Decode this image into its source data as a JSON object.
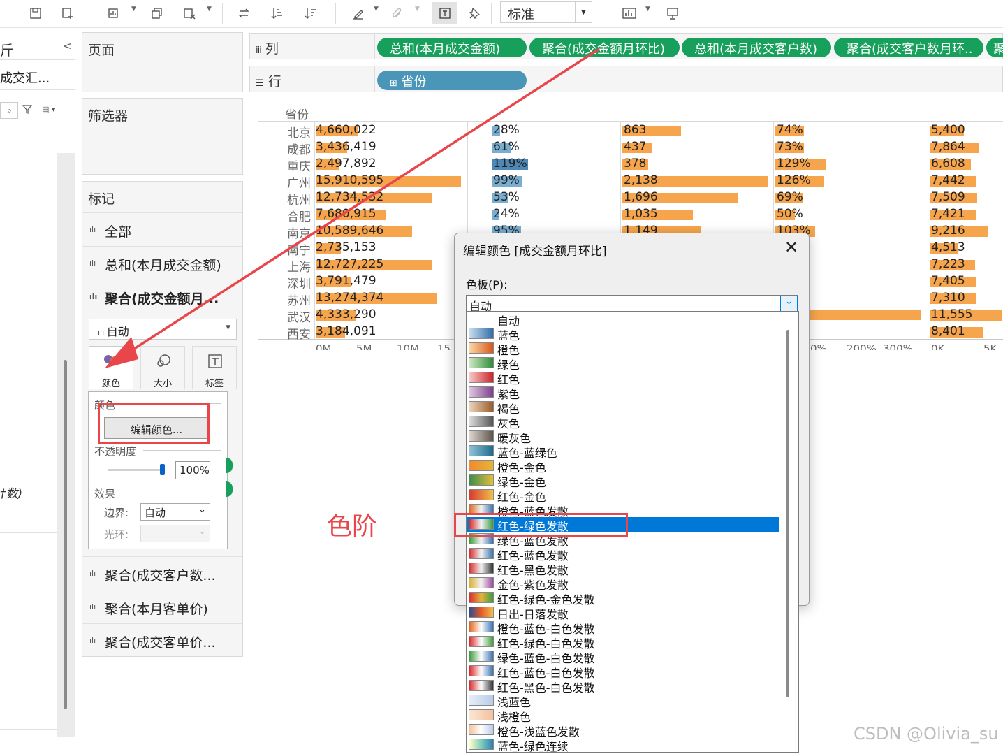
{
  "toolbar": {
    "fit_select": "标准",
    "icons": [
      "save-icon",
      "new-datasource-icon",
      "new-worksheet-icon",
      "duplicate-icon",
      "clear-sheet-icon",
      "swap-icon",
      "sort-asc-icon",
      "sort-desc-icon",
      "highlight-icon",
      "group-icon",
      "label-icon",
      "pin-icon",
      "show-me-icon",
      "presentation-icon"
    ]
  },
  "left_pane": {
    "title_fragment": "斤",
    "source_fragment": "成交汇...",
    "collapse": "<",
    "field_fragment": "†数)"
  },
  "cards": {
    "pages": "页面",
    "filters": "筛选器",
    "marks": "标记",
    "mark_rows": [
      {
        "label": "全部",
        "bold": false
      },
      {
        "label": "总和(本月成交金额)",
        "bold": false
      },
      {
        "label": "聚合(成交金额月...",
        "bold": true
      }
    ],
    "mark_type": "自动",
    "mark_buttons": {
      "color": "颜色",
      "size": "大小",
      "label": "标签"
    },
    "popup": {
      "color_title": "颜色",
      "edit_color": "编辑颜色...",
      "opacity_title": "不透明度",
      "opacity_value": "100%",
      "effects_title": "效果",
      "border_label": "边界:",
      "border_value": "自动",
      "halo_label": "光环:"
    },
    "more_rows": [
      "聚合(成交客户数...",
      "聚合(本月客单价)",
      "聚合(成交客单价..."
    ]
  },
  "shelves": {
    "columns_label": "列",
    "rows_label": "行",
    "column_pills": [
      "总和(本月成交金额)",
      "聚合(成交金额月环比)",
      "总和(本月成交客户数)",
      "聚合(成交客户数月环..",
      "聚"
    ],
    "row_pills": [
      "省份"
    ]
  },
  "viz": {
    "header": "省份",
    "cities": [
      "北京",
      "成都",
      "重庆",
      "广州",
      "杭州",
      "合肥",
      "南京",
      "南宁",
      "上海",
      "深圳",
      "苏州",
      "武汉",
      "西安"
    ],
    "amount_labels": [
      "4,660,022",
      "3,436,419",
      "2,497,892",
      "15,910,595",
      "12,734,532",
      "7,680,915",
      "10,589,646",
      "2,735,153",
      "12,727,225",
      "3,791,479",
      "13,274,374",
      "4,333,290",
      "3,184,091"
    ],
    "amount_values": [
      4660022,
      3436419,
      2497892,
      15910595,
      12734532,
      7680915,
      10589646,
      2735153,
      12727225,
      3791479,
      13274374,
      4333290,
      3184091
    ],
    "amount_mom_labels": [
      "28%",
      "61%",
      "119%",
      "99%",
      "53%",
      "24%",
      "95%"
    ],
    "amount_mom_values": [
      28,
      61,
      119,
      99,
      53,
      24,
      95
    ],
    "customer_labels": [
      "863",
      "437",
      "378",
      "2,138",
      "1,696",
      "1,035",
      "1,149"
    ],
    "customer_values": [
      863,
      437,
      378,
      2138,
      1696,
      1035,
      1149
    ],
    "customer_mom_labels": [
      "74%",
      "73%",
      "129%",
      "126%",
      "69%",
      "50%",
      "103%"
    ],
    "customer_mom_values": [
      74,
      73,
      129,
      126,
      69,
      50,
      103
    ],
    "price_labels": [
      "5,400",
      "7,864",
      "6,608",
      "7,442",
      "7,509",
      "7,421",
      "9,216",
      "4,513",
      "7,223",
      "7,405",
      "7,310",
      "11,555",
      "8,401"
    ],
    "price_values": [
      5400,
      7864,
      6608,
      7442,
      7509,
      7421,
      9216,
      4513,
      7223,
      7405,
      7310,
      11555,
      8401
    ],
    "axis_ticks_1": [
      "0M",
      "5M",
      "10M",
      "15"
    ],
    "axis_ticks_4": [
      "0%",
      "200%",
      "300%"
    ],
    "axis_ticks_5": [
      "0K",
      "5K"
    ],
    "colors": {
      "orange": "#f6a54c",
      "blue": "#79aed0",
      "blue_dark": "#4e88b6"
    }
  },
  "dialog": {
    "title": "编辑颜色 [成交金额月环比]",
    "palette_label": "色板(P):",
    "palette_value": "自动",
    "palettes": [
      {
        "name": "自动",
        "colors": []
      },
      {
        "name": "蓝色",
        "colors": [
          "#c9ddee",
          "#2f6ea6"
        ]
      },
      {
        "name": "橙色",
        "colors": [
          "#fcd7a6",
          "#d8571b"
        ]
      },
      {
        "name": "绿色",
        "colors": [
          "#cfe8c4",
          "#2f8a3a"
        ]
      },
      {
        "name": "红色",
        "colors": [
          "#f8c8c8",
          "#c8252b"
        ]
      },
      {
        "name": "紫色",
        "colors": [
          "#e0c8e3",
          "#7b3f89"
        ]
      },
      {
        "name": "褐色",
        "colors": [
          "#ead4b8",
          "#9a5b2c"
        ]
      },
      {
        "name": "灰色",
        "colors": [
          "#dddddd",
          "#555555"
        ]
      },
      {
        "name": "暖灰色",
        "colors": [
          "#ddd6cf",
          "#5e544c"
        ]
      },
      {
        "name": "蓝色-蓝绿色",
        "colors": [
          "#8fc3d6",
          "#1f6a8e"
        ]
      },
      {
        "name": "橙色-金色",
        "colors": [
          "#f28a2e",
          "#e6b43a"
        ]
      },
      {
        "name": "绿色-金色",
        "colors": [
          "#3e8d4a",
          "#e2bf3c"
        ]
      },
      {
        "name": "红色-金色",
        "colors": [
          "#d63a32",
          "#f0c04a"
        ]
      },
      {
        "name": "橙色-蓝色发散",
        "colors": [
          "#e0671e",
          "#f2f2f2",
          "#3a72b0"
        ]
      },
      {
        "name": "红色-绿色发散",
        "colors": [
          "#d62d2d",
          "#f2f2f2",
          "#3e9b3e"
        ]
      },
      {
        "name": "绿色-蓝色发散",
        "colors": [
          "#3e9b3e",
          "#f2f2f2",
          "#3a72b0"
        ]
      },
      {
        "name": "红色-蓝色发散",
        "colors": [
          "#d62d2d",
          "#f2f2f2",
          "#3a72b0"
        ]
      },
      {
        "name": "红色-黑色发散",
        "colors": [
          "#d62d2d",
          "#f2f2f2",
          "#333333"
        ]
      },
      {
        "name": "金色-紫色发散",
        "colors": [
          "#d9b03a",
          "#f2f2f2",
          "#9b4aa0"
        ]
      },
      {
        "name": "红色-绿色-金色发散",
        "colors": [
          "#d62d2d",
          "#e6b43a",
          "#3e9b3e"
        ]
      },
      {
        "name": "日出-日落发散",
        "colors": [
          "#2b4c8c",
          "#e85a2a",
          "#f0c04a"
        ]
      },
      {
        "name": "橙色-蓝色-白色发散",
        "colors": [
          "#e0671e",
          "#ffffff",
          "#3a72b0"
        ]
      },
      {
        "name": "红色-绿色-白色发散",
        "colors": [
          "#d62d2d",
          "#ffffff",
          "#3e9b3e"
        ]
      },
      {
        "name": "绿色-蓝色-白色发散",
        "colors": [
          "#3e9b3e",
          "#ffffff",
          "#3a72b0"
        ]
      },
      {
        "name": "红色-蓝色-白色发散",
        "colors": [
          "#d62d2d",
          "#ffffff",
          "#3a72b0"
        ]
      },
      {
        "name": "红色-黑色-白色发散",
        "colors": [
          "#d62d2d",
          "#ffffff",
          "#333333"
        ]
      },
      {
        "name": "浅蓝色",
        "colors": [
          "#e6eef8",
          "#b9cce6"
        ]
      },
      {
        "name": "浅橙色",
        "colors": [
          "#fbe6d4",
          "#f3c29e"
        ]
      },
      {
        "name": "橙色-浅蓝色发散",
        "colors": [
          "#f3c29e",
          "#ffffff",
          "#b9cce6"
        ]
      },
      {
        "name": "蓝色-绿色连续",
        "colors": [
          "#ffffcc",
          "#7fcdbb",
          "#2c7fb8"
        ]
      }
    ],
    "selected_index": 14
  },
  "annotations": {
    "text": "色阶",
    "color": "#e8464a"
  },
  "watermark": "CSDN @Olivia_su"
}
